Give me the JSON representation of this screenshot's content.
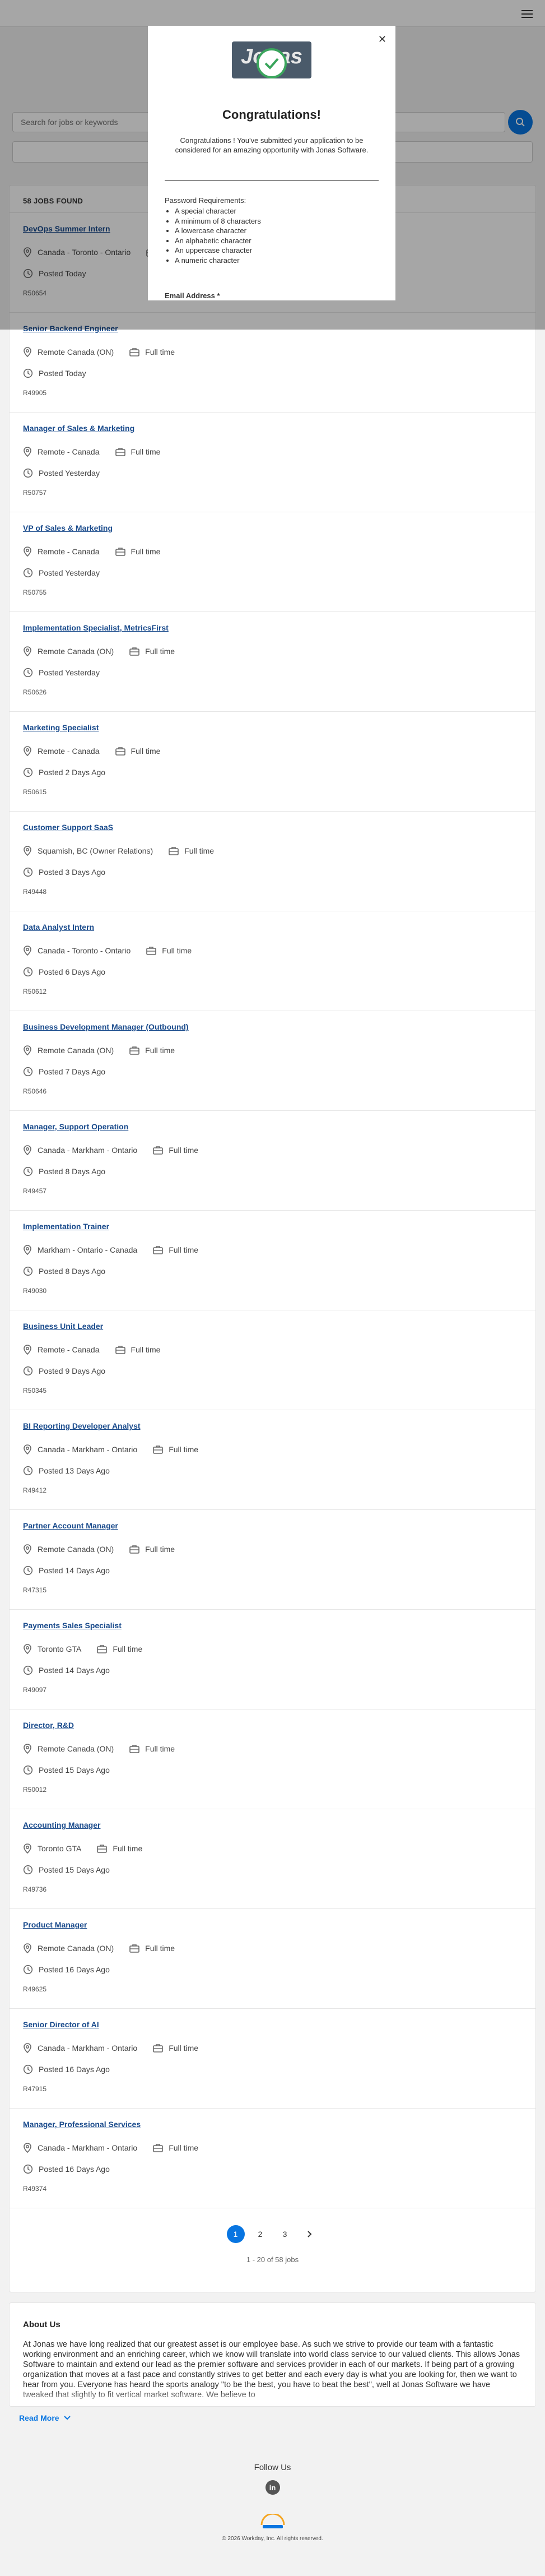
{
  "search": {
    "placeholder": "Search for jobs or keywords"
  },
  "results": {
    "count_label": "58 JOBS FOUND"
  },
  "jobs": [
    {
      "title": "DevOps Summer Intern",
      "location": "Canada - Toronto - Ontario",
      "type": "Full time",
      "posted": "Posted Today",
      "id": "R50654"
    },
    {
      "title": "Senior Backend Engineer",
      "location": "Remote Canada (ON)",
      "type": "Full time",
      "posted": "Posted Today",
      "id": "R49905"
    },
    {
      "title": "Manager of Sales & Marketing",
      "location": "Remote - Canada",
      "type": "Full time",
      "posted": "Posted Yesterday",
      "id": "R50757"
    },
    {
      "title": "VP of Sales & Marketing",
      "location": "Remote - Canada",
      "type": "Full time",
      "posted": "Posted Yesterday",
      "id": "R50755"
    },
    {
      "title": "Implementation Specialist, MetricsFirst",
      "location": "Remote Canada (ON)",
      "type": "Full time",
      "posted": "Posted Yesterday",
      "id": "R50626"
    },
    {
      "title": "Marketing Specialist",
      "location": "Remote - Canada",
      "type": "Full time",
      "posted": "Posted 2 Days Ago",
      "id": "R50615"
    },
    {
      "title": "Customer Support SaaS",
      "location": "Squamish, BC (Owner Relations)",
      "type": "Full time",
      "posted": "Posted 3 Days Ago",
      "id": "R49448"
    },
    {
      "title": "Data Analyst Intern",
      "location": "Canada - Toronto - Ontario",
      "type": "Full time",
      "posted": "Posted 6 Days Ago",
      "id": "R50612"
    },
    {
      "title": "Business Development Manager (Outbound)",
      "location": "Remote Canada (ON)",
      "type": "Full time",
      "posted": "Posted 7 Days Ago",
      "id": "R50646"
    },
    {
      "title": "Manager, Support Operation",
      "location": "Canada - Markham - Ontario",
      "type": "Full time",
      "posted": "Posted 8 Days Ago",
      "id": "R49457"
    },
    {
      "title": "Implementation Trainer",
      "location": "Markham - Ontario - Canada",
      "type": "Full time",
      "posted": "Posted 8 Days Ago",
      "id": "R49030"
    },
    {
      "title": "Business Unit Leader",
      "location": "Remote - Canada",
      "type": "Full time",
      "posted": "Posted 9 Days Ago",
      "id": "R50345"
    },
    {
      "title": "BI Reporting Developer Analyst",
      "location": "Canada - Markham - Ontario",
      "type": "Full time",
      "posted": "Posted 13 Days Ago",
      "id": "R49412"
    },
    {
      "title": "Partner Account Manager",
      "location": "Remote Canada (ON)",
      "type": "Full time",
      "posted": "Posted 14 Days Ago",
      "id": "R47315"
    },
    {
      "title": "Payments Sales Specialist",
      "location": "Toronto GTA",
      "type": "Full time",
      "posted": "Posted 14 Days Ago",
      "id": "R49097"
    },
    {
      "title": "Director, R&D",
      "location": "Remote Canada (ON)",
      "type": "Full time",
      "posted": "Posted 15 Days Ago",
      "id": "R50012"
    },
    {
      "title": "Accounting Manager",
      "location": "Toronto GTA",
      "type": "Full time",
      "posted": "Posted 15 Days Ago",
      "id": "R49736"
    },
    {
      "title": "Product Manager",
      "location": "Remote Canada (ON)",
      "type": "Full time",
      "posted": "Posted 16 Days Ago",
      "id": "R49625"
    },
    {
      "title": "Senior Director of AI",
      "location": "Canada - Markham - Ontario",
      "type": "Full time",
      "posted": "Posted 16 Days Ago",
      "id": "R47915"
    },
    {
      "title": "Manager, Professional Services",
      "location": "Canada - Markham - Ontario",
      "type": "Full time",
      "posted": "Posted 16 Days Ago",
      "id": "R49374"
    }
  ],
  "pagination": {
    "pages": [
      "1",
      "2",
      "3"
    ],
    "active": "1",
    "summary": "1 - 20 of 58 jobs"
  },
  "about": {
    "heading": "About Us",
    "text": "At Jonas we have long realized that our greatest asset is our employee base. As such we strive to provide our team with a fantastic working environment and an enriching career, which we know will translate into world class service to our valued clients. This allows Jonas Software to maintain and extend our lead as the premier software and services provider in each of our markets. If being part of a growing organization that moves at a fast pace and constantly strives to get better and each every day is what you are looking for, then we want to hear from you. Everyone has heard the sports analogy \"to be the best, you have to beat the best\", well at Jonas Software we have tweaked that slightly to fit vertical market software. We believe to",
    "read_more": "Read More"
  },
  "footer": {
    "follow": "Follow Us",
    "linkedin": "in",
    "copyright": "© 2026 Workday, Inc. All rights reserved."
  },
  "modal": {
    "logo_text": "Jonas",
    "title": "Congratulations!",
    "message": "Congratulations ! You've submitted your application to be considered for an amazing opportunity with Jonas Software.",
    "password_title": "Password Requirements:",
    "password_rules": [
      "A special character",
      "A minimum of 8 characters",
      "A lowercase character",
      "An alphabetic character",
      "An uppercase character",
      "A numeric character"
    ],
    "email_label": "Email Address *"
  },
  "colors": {
    "accent": "#0875e1",
    "title_link": "#1a4b8c",
    "success": "#3aa55c"
  }
}
